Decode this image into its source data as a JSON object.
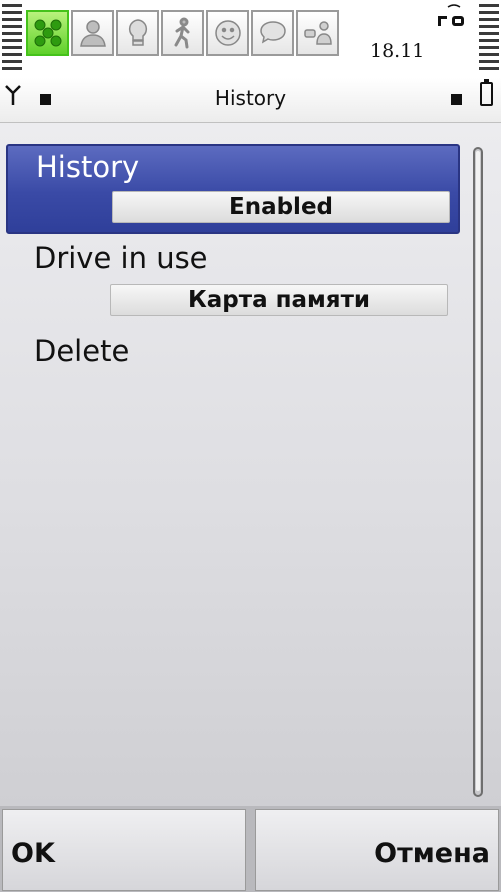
{
  "status": {
    "time": "18.11",
    "plugins": [
      "contacts-group-icon",
      "person-icon",
      "lightbulb-icon",
      "walking-person-icon",
      "smiley-icon",
      "speech-bubble-icon",
      "person-chat-icon"
    ]
  },
  "titlebar": {
    "title": "History"
  },
  "settings": [
    {
      "label": "History",
      "value": "Enabled",
      "selected": true
    },
    {
      "label": "Drive in use",
      "value": "Карта памяти",
      "selected": false
    },
    {
      "label": "Delete",
      "value": "",
      "selected": false
    }
  ],
  "softkeys": {
    "left": "OK",
    "right": "Отмена"
  },
  "colors": {
    "selection": "#3a4aa6",
    "active_plugin": "#5fd02a"
  }
}
